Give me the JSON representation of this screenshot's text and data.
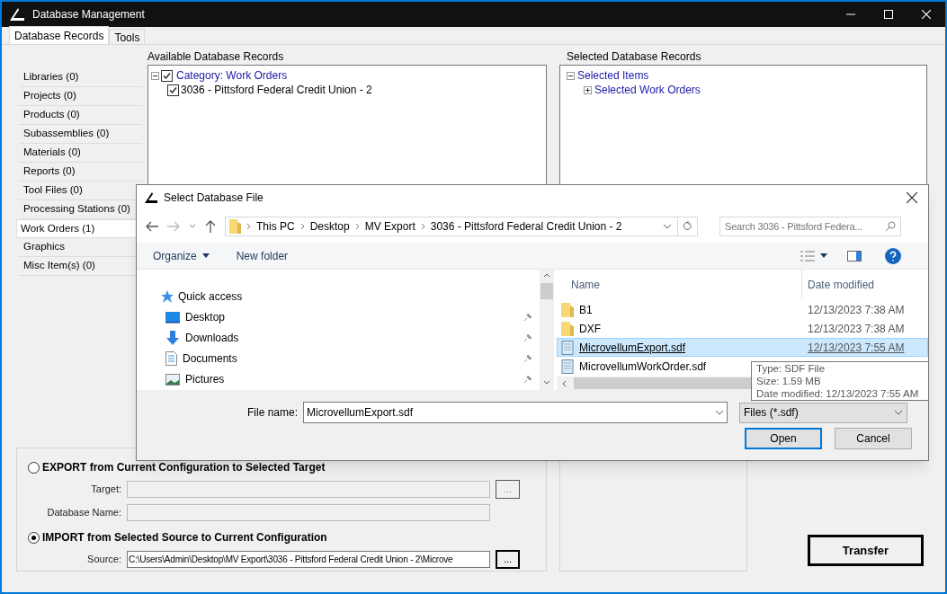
{
  "window": {
    "title": "Database Management"
  },
  "tabs": [
    {
      "label": "Database Records",
      "selected": true
    },
    {
      "label": "Tools",
      "selected": false
    }
  ],
  "categories": [
    {
      "label": "Libraries (0)",
      "selected": false
    },
    {
      "label": "Projects (0)",
      "selected": false
    },
    {
      "label": "Products (0)",
      "selected": false
    },
    {
      "label": "Subassemblies (0)",
      "selected": false
    },
    {
      "label": "Materials (0)",
      "selected": false
    },
    {
      "label": "Reports (0)",
      "selected": false
    },
    {
      "label": "Tool Files (0)",
      "selected": false
    },
    {
      "label": "Processing Stations (0)",
      "selected": false
    },
    {
      "label": "Work Orders (1)",
      "selected": true
    },
    {
      "label": "Graphics",
      "selected": false
    },
    {
      "label": "Misc Item(s) (0)",
      "selected": false
    }
  ],
  "available": {
    "title": "Available Database Records",
    "tree": [
      {
        "label": "Category: Work Orders",
        "checked": true,
        "expanded": true,
        "children": [
          {
            "label": "3036 - Pittsford Federal Credit Union - 2",
            "checked": true
          }
        ]
      }
    ]
  },
  "selected_records": {
    "title": "Selected Database Records",
    "tree": [
      {
        "label": "Selected Items",
        "expanded": true,
        "children": [
          {
            "label": "Selected Work Orders",
            "expanded": false
          }
        ]
      }
    ]
  },
  "modes": [
    {
      "label": "EXPORT from Current Configuration to Selected Target",
      "selected": false,
      "fields": [
        {
          "label": "Target:",
          "browse": "..."
        },
        {
          "label": "Database Name:"
        }
      ]
    },
    {
      "label": "IMPORT from Selected Source to Current Configuration",
      "selected": true,
      "fields": [
        {
          "label": "Source:",
          "value": "C:\\Users\\Admin\\Desktop\\MV Export\\3036 - Pittsford Federal Credit Union - 2\\Microve",
          "browse": "..."
        }
      ]
    }
  ],
  "transfer_button": "Transfer",
  "dialog": {
    "title": "Select Database File",
    "breadcrumb": [
      "This PC",
      "Desktop",
      "MV Export",
      "3036 - Pittsford Federal Credit Union - 2"
    ],
    "search": {
      "placeholder": "Search 3036 - Pittsford Federa..."
    },
    "toolbar": [
      "Organize",
      "New folder"
    ],
    "nav": [
      {
        "label": "Quick access",
        "kind": "star"
      },
      {
        "label": "Desktop",
        "kind": "desktop"
      },
      {
        "label": "Downloads",
        "kind": "download"
      },
      {
        "label": "Documents",
        "kind": "document"
      },
      {
        "label": "Pictures",
        "kind": "pictures"
      }
    ],
    "columns": [
      "Name",
      "Date modified"
    ],
    "files": [
      {
        "name": "B1",
        "date": "12/13/2023 7:38 AM",
        "kind": "folder",
        "selected": false
      },
      {
        "name": "DXF",
        "date": "12/13/2023 7:38 AM",
        "kind": "folder",
        "selected": false
      },
      {
        "name": "MicrovellumExport.sdf",
        "date": "12/13/2023 7:55 AM",
        "kind": "file",
        "selected": true
      },
      {
        "name": "MicrovellumWorkOrder.sdf",
        "kind": "file",
        "selected": false
      }
    ],
    "file_name": {
      "label": "File name:",
      "value": "MicrovellumExport.sdf"
    },
    "filter": "Files (*.sdf)",
    "buttons": [
      {
        "label": "Open",
        "kind": "primary"
      },
      {
        "label": "Cancel",
        "kind": "normal"
      }
    ],
    "tooltip": [
      "Type: SDF File",
      "Size: 1.59 MB",
      "Date modified: 12/13/2023 7:55 AM"
    ]
  }
}
